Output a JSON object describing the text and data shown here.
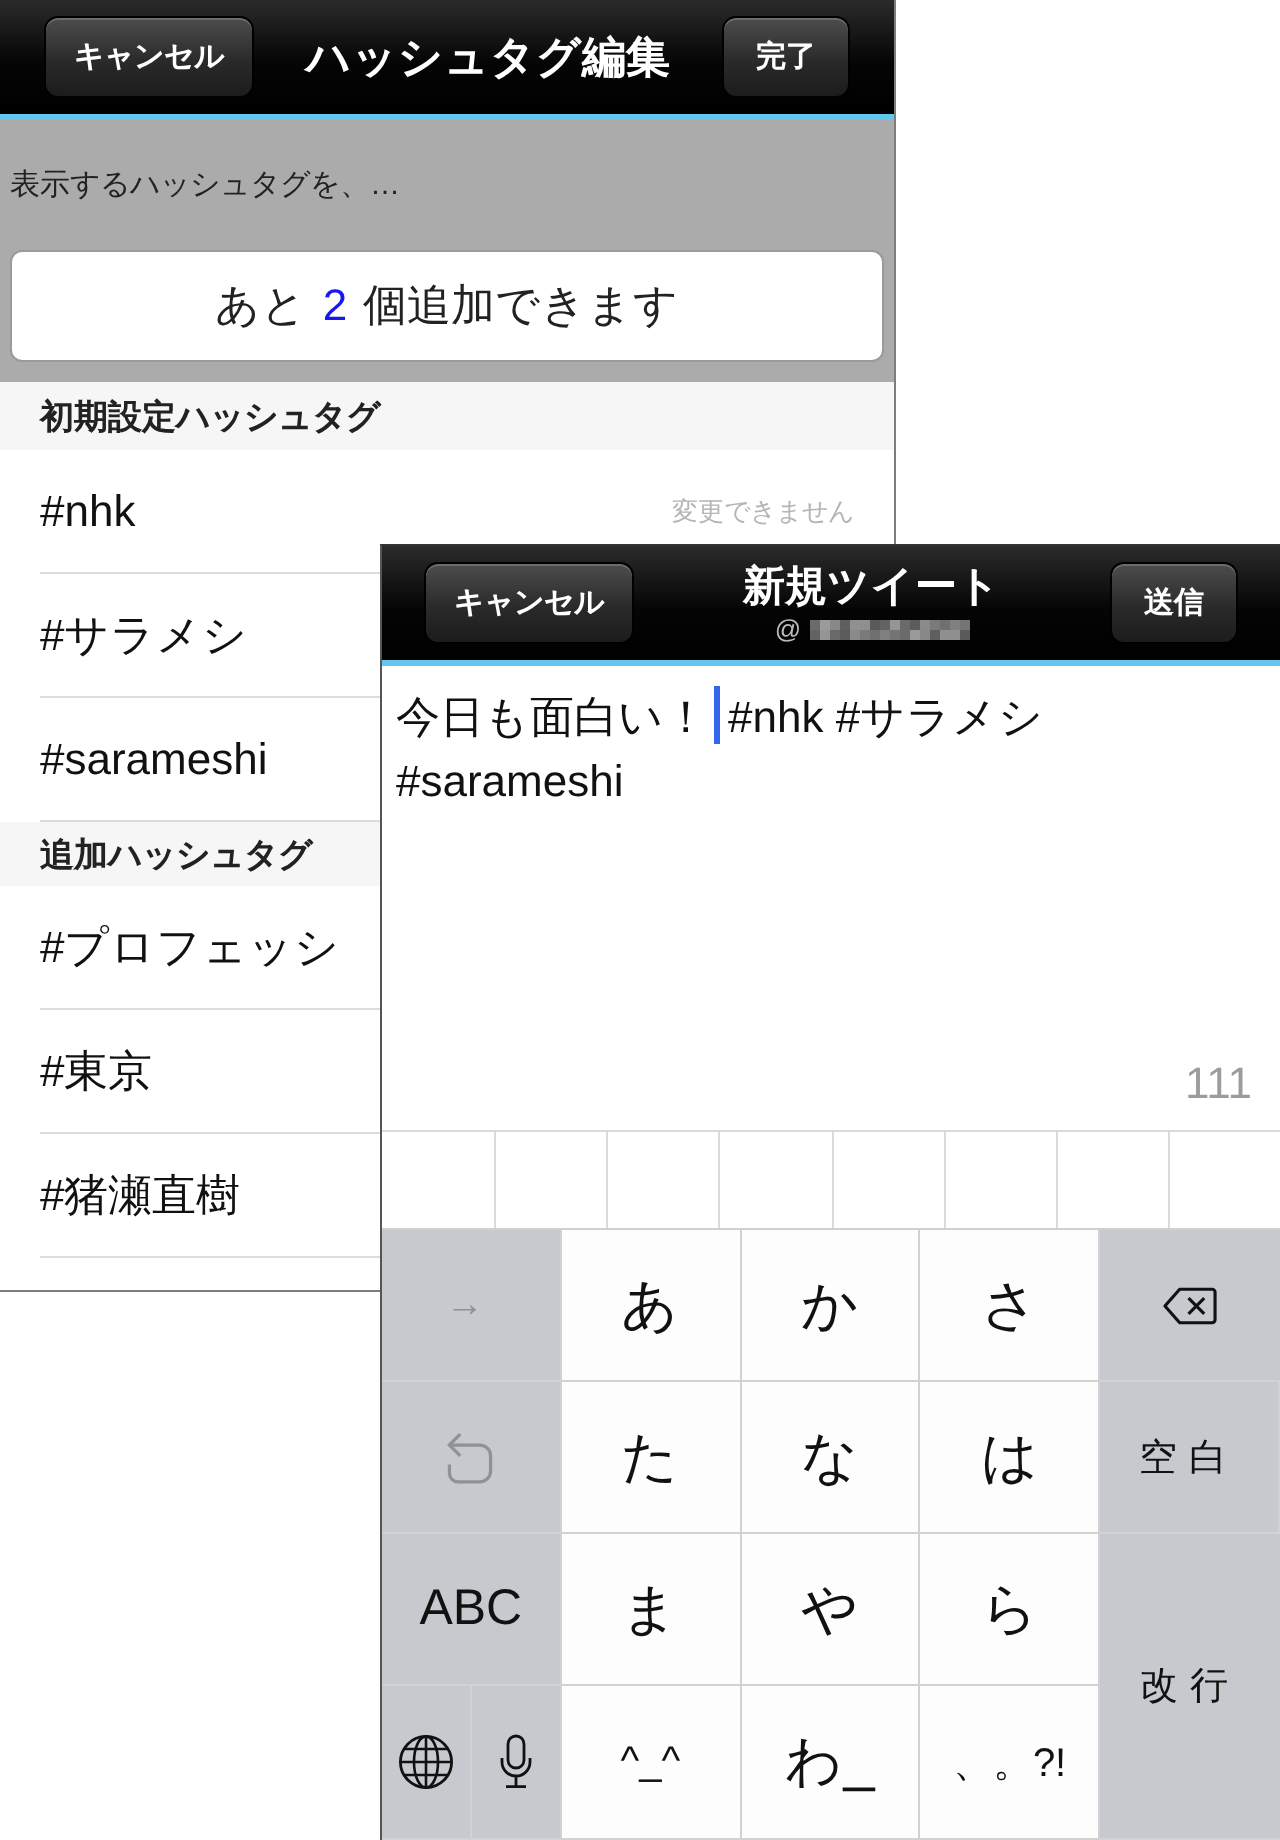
{
  "hashtag_editor": {
    "nav_bar": {
      "cancel_button": "キャンセル",
      "title": "ハッシュタグ編集",
      "done_button": "完了"
    },
    "description": "表示するハッシュタグを、…",
    "remaining_notice": {
      "before": "あと",
      "count": "2",
      "after": "個追加できます"
    },
    "sections": [
      {
        "title": "初期設定ハッシュタグ",
        "rows": [
          {
            "hashtag": "#nhk",
            "note": "変更できません"
          },
          {
            "hashtag": "#サラメシ"
          },
          {
            "hashtag": "#sarameshi"
          }
        ]
      },
      {
        "title": "追加ハッシュタグ",
        "rows": [
          {
            "hashtag": "#プロフェッシ"
          },
          {
            "hashtag": "#東京"
          },
          {
            "hashtag": "#猪瀬直樹"
          }
        ]
      }
    ]
  },
  "compose": {
    "nav_bar": {
      "cancel_button": "キャンセル",
      "title": "新規ツイート",
      "account": "@",
      "send_button": "送信"
    },
    "text_before_cursor": "今日も面白い！",
    "text_after_cursor": "#nhk #サラメシ #sarameshi",
    "remaining_count": "111"
  },
  "keyboard": {
    "keys": [
      {
        "kind": "function",
        "label": "→",
        "disabled": true
      },
      {
        "kind": "kana",
        "label": "あ",
        "disabled": false
      },
      {
        "kind": "kana",
        "label": "か",
        "disabled": false
      },
      {
        "kind": "kana",
        "label": "さ",
        "disabled": false
      },
      {
        "kind": "delete",
        "disabled": false
      },
      {
        "kind": "undo",
        "disabled": true
      },
      {
        "kind": "kana",
        "label": "た",
        "disabled": false
      },
      {
        "kind": "kana",
        "label": "な",
        "disabled": false
      },
      {
        "kind": "kana",
        "label": "は",
        "disabled": false
      },
      {
        "kind": "function",
        "label": "空白",
        "disabled": false
      },
      {
        "kind": "function",
        "label": "ABC",
        "disabled": false
      },
      {
        "kind": "kana",
        "label": "ま",
        "disabled": false
      },
      {
        "kind": "kana",
        "label": "や",
        "disabled": false
      },
      {
        "kind": "kana",
        "label": "ら",
        "disabled": false
      },
      {
        "kind": "return",
        "label": "改行",
        "disabled": false
      },
      {
        "kind": "globe",
        "disabled": false
      },
      {
        "kind": "mic",
        "disabled": false
      },
      {
        "kind": "kana",
        "label": "^_^",
        "disabled": false
      },
      {
        "kind": "kana",
        "label": "わ_",
        "disabled": false
      },
      {
        "kind": "kana",
        "label": "、。?!",
        "disabled": false
      }
    ]
  }
}
